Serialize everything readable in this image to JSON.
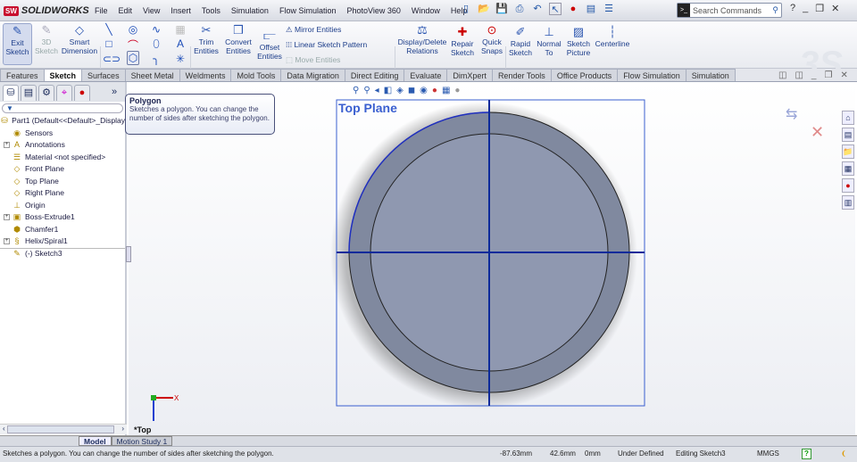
{
  "app": {
    "name": "SOLIDWORKS",
    "logo_mark": "SW"
  },
  "menu": [
    "File",
    "Edit",
    "View",
    "Insert",
    "Tools",
    "Simulation",
    "Flow Simulation",
    "PhotoView 360",
    "Window",
    "Help"
  ],
  "search": {
    "placeholder": "Search Commands"
  },
  "ribbon": {
    "exit_sketch": "Exit Sketch",
    "sketch_3d": "3D Sketch",
    "smart_dimension": "Smart Dimension",
    "trim": "Trim Entities",
    "convert": "Convert Entities",
    "offset": "Offset Entities",
    "mirror": "Mirror Entities",
    "linear_pattern": "Linear Sketch Pattern",
    "move": "Move Entities",
    "display_delete": "Display/Delete Relations",
    "repair": "Repair Sketch",
    "quick_snaps": "Quick Snaps",
    "rapid": "Rapid Sketch",
    "normal_to": "Normal To",
    "sketch_picture": "Sketch Picture",
    "centerline": "Centerline"
  },
  "tabs": [
    "Features",
    "Sketch",
    "Surfaces",
    "Sheet Metal",
    "Weldments",
    "Mold Tools",
    "Data Migration",
    "Direct Editing",
    "Evaluate",
    "DimXpert",
    "Render Tools",
    "Office Products",
    "Flow Simulation",
    "Simulation"
  ],
  "active_tab": "Sketch",
  "tooltip": {
    "title": "Polygon",
    "body": "Sketches a polygon. You can change the number of sides after sketching the polygon."
  },
  "tree": {
    "root": "Part1  (Default<<Default>_Display",
    "items": [
      {
        "label": "Sensors",
        "icon": "sensor-icon",
        "expand": false
      },
      {
        "label": "Annotations",
        "icon": "annotations-icon",
        "expand": true
      },
      {
        "label": "Material <not specified>",
        "icon": "material-icon",
        "expand": false
      },
      {
        "label": "Front Plane",
        "icon": "plane-icon",
        "expand": false
      },
      {
        "label": "Top Plane",
        "icon": "plane-icon",
        "expand": false
      },
      {
        "label": "Right Plane",
        "icon": "plane-icon",
        "expand": false
      },
      {
        "label": "Origin",
        "icon": "origin-icon",
        "expand": false
      },
      {
        "label": "Boss-Extrude1",
        "icon": "extrude-icon",
        "expand": true
      },
      {
        "label": "Chamfer1",
        "icon": "chamfer-icon",
        "expand": false
      },
      {
        "label": "Helix/Spiral1",
        "icon": "helix-icon",
        "expand": true
      },
      {
        "label": "(-) Sketch3",
        "icon": "sketch-icon",
        "expand": false
      }
    ]
  },
  "viewport": {
    "plane_label": "Top Plane",
    "view_name": "*Top",
    "axis_x": "X"
  },
  "bottom_tabs": [
    "Model",
    "Motion Study 1"
  ],
  "status": {
    "message": "Sketches a polygon. You can change the number of sides after sketching the polygon.",
    "x": "-87.63mm",
    "y": "42.6mm",
    "z": "0mm",
    "state": "Under Defined",
    "editing": "Editing Sketch3",
    "units": "MMGS"
  },
  "colors": {
    "sketch_line": "#0a2a9a",
    "part_face": "#8e97ae",
    "plane": "#3a5fd0"
  }
}
